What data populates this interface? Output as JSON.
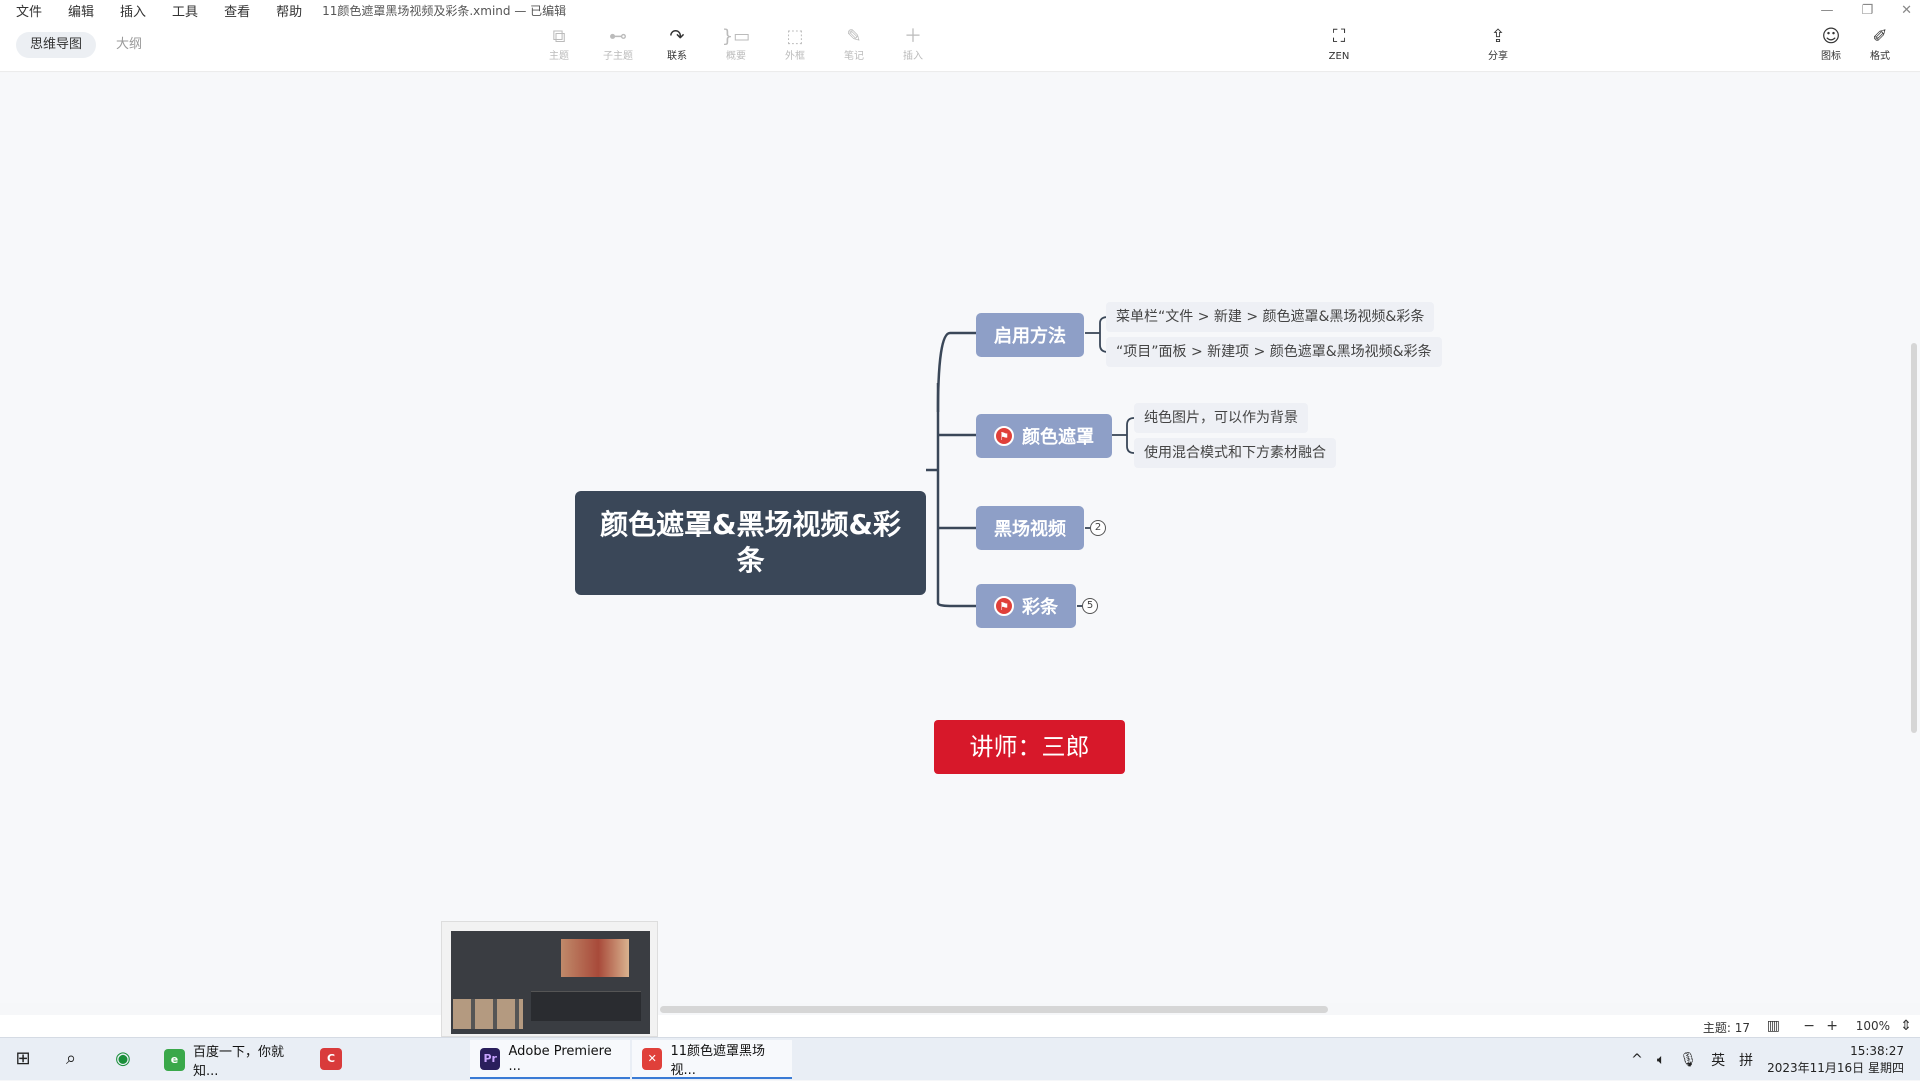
{
  "menubar": {
    "items": [
      "文件",
      "编辑",
      "插入",
      "工具",
      "查看",
      "帮助"
    ],
    "file_title": "11颜色遮罩黑场视频及彩条.xmind — 已编辑"
  },
  "toolbar": {
    "view_tabs": [
      "思维导图",
      "大纲"
    ],
    "tools": [
      {
        "label": "主题",
        "icon": "topic-icon"
      },
      {
        "label": "子主题",
        "icon": "subtopic-icon"
      },
      {
        "label": "联系",
        "icon": "relationship-icon"
      },
      {
        "label": "概要",
        "icon": "summary-icon"
      },
      {
        "label": "外框",
        "icon": "boundary-icon"
      },
      {
        "label": "笔记",
        "icon": "note-icon"
      },
      {
        "label": "插入",
        "icon": "plus-icon"
      },
      {
        "label": "ZEN",
        "icon": "zen-icon"
      },
      {
        "label": "分享",
        "icon": "share-icon"
      },
      {
        "label": "图标",
        "icon": "smiley-icon"
      },
      {
        "label": "格式",
        "icon": "format-brush-icon"
      }
    ]
  },
  "mindmap": {
    "central": "颜色遮罩&黑场视频&彩条",
    "branches": [
      {
        "label": "启用方法",
        "flag": false,
        "children": [
          "菜单栏“文件 > 新建 > 颜色遮罩&黑场视频&彩条",
          "“项目”面板 > 新建项 >  颜色遮罩&黑场视频&彩条"
        ]
      },
      {
        "label": "颜色遮罩",
        "flag": true,
        "children": [
          "纯色图片，可以作为背景",
          "使用混合模式和下方素材融合"
        ]
      },
      {
        "label": "黑场视频",
        "flag": false,
        "collapsed_count": "2"
      },
      {
        "label": "彩条",
        "flag": true,
        "collapsed_count": "5"
      }
    ],
    "lecturer": "讲师：三郎"
  },
  "statusbar": {
    "topics": "主题: 17",
    "zoom": "100%"
  },
  "taskbar": {
    "apps": [
      {
        "label": "百度一下，你就知...",
        "icon": "browser-360-icon"
      },
      {
        "label": "Adobe Premiere ...",
        "icon": "premiere-icon",
        "badge": "Pr"
      },
      {
        "label": "11颜色遮罩黑场视...",
        "icon": "xmind-icon"
      }
    ],
    "ime": "英",
    "ime2": "拼",
    "time": "15:38:27",
    "date": "2023年11月16日 星期四"
  },
  "colors": {
    "central": "#3a4758",
    "branch": "#8e9fc7",
    "flag": "#e0403a",
    "lecturer": "#d7182a"
  }
}
